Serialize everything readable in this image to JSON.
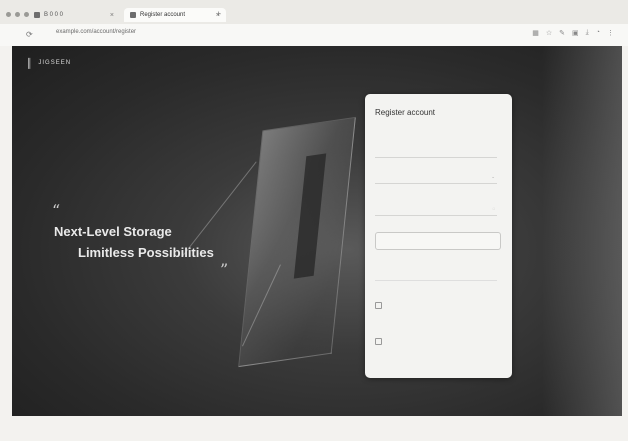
{
  "browser": {
    "tabs": [
      {
        "label": "B 0 0 0"
      },
      {
        "label": "Register account"
      }
    ],
    "url": "example.com/account/register"
  },
  "page": {
    "logo_text": "JIGSEEN",
    "headline_line1": "Next-Level Storage",
    "headline_line2": "Limitless Possibilities",
    "quote_open": "“",
    "quote_close": "”"
  },
  "register": {
    "title": "Register account",
    "subtitle": "",
    "field1_value": "",
    "field2_value": "",
    "field3_label": "",
    "field3_value": "",
    "button_label": "",
    "helper": "",
    "checkbox1_text": "",
    "checkbox2_text": ""
  }
}
